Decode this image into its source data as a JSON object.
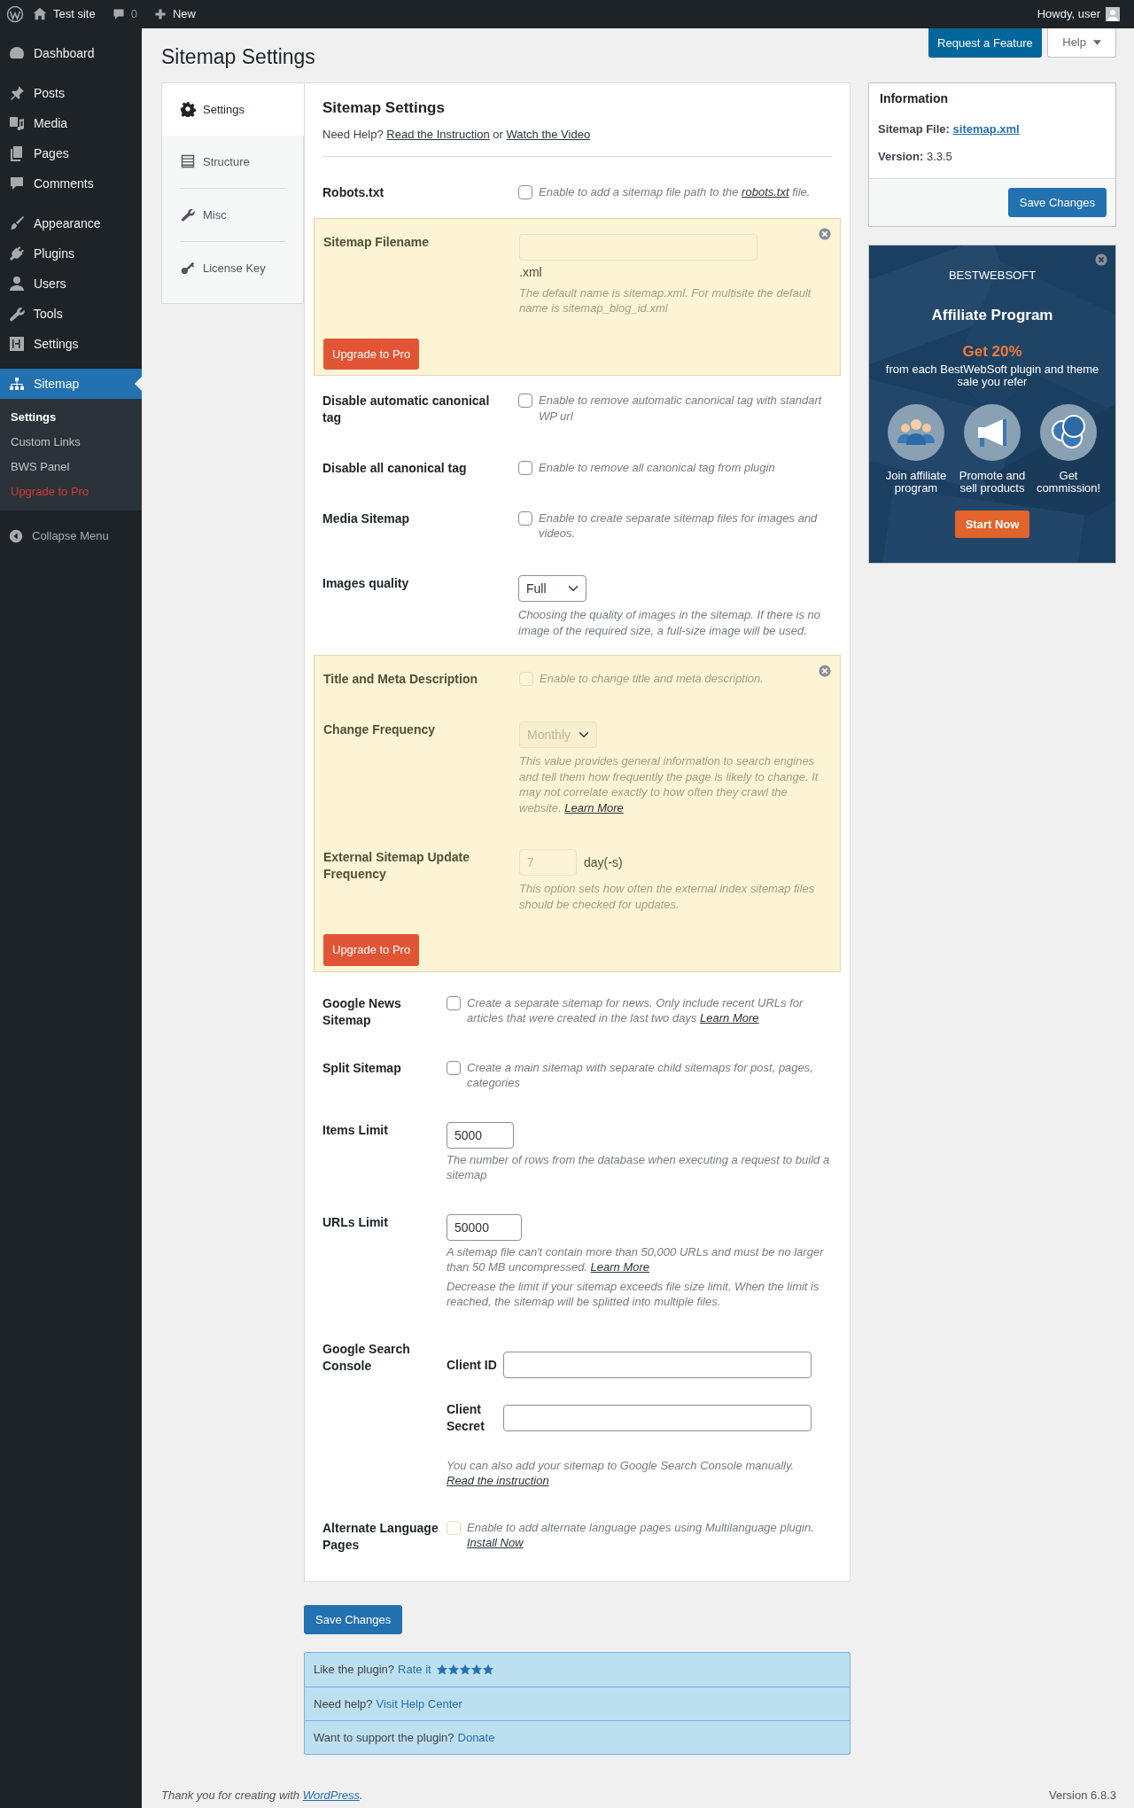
{
  "admin_bar": {
    "site": "Test site",
    "comments": "0",
    "new": "New",
    "greeting": "Howdy, user"
  },
  "sidebar": {
    "groups": [
      {
        "items": [
          {
            "label": "Dashboard",
            "selected": false
          }
        ]
      },
      {
        "items": [
          {
            "label": "Posts",
            "selected": false
          },
          {
            "label": "Media",
            "selected": false
          },
          {
            "label": "Pages",
            "selected": false
          },
          {
            "label": "Comments",
            "selected": false
          }
        ]
      },
      {
        "items": [
          {
            "label": "Appearance",
            "selected": false
          },
          {
            "label": "Plugins",
            "selected": false
          },
          {
            "label": "Users",
            "selected": false
          },
          {
            "label": "Tools",
            "selected": false
          },
          {
            "label": "Settings",
            "selected": false
          }
        ]
      },
      {
        "items": [
          {
            "label": "Sitemap",
            "selected": true,
            "children": [
              {
                "label": "Settings",
                "selected": true,
                "kind": "plain"
              },
              {
                "label": "Custom Links",
                "selected": false,
                "kind": "plain"
              },
              {
                "label": "BWS Panel",
                "selected": false,
                "kind": "plain"
              },
              {
                "label": "Upgrade to Pro",
                "selected": false,
                "kind": "upgrade"
              }
            ]
          }
        ]
      }
    ],
    "collapse": "Collapse Menu"
  },
  "page": {
    "title": "Sitemap Settings",
    "buttons": [
      {
        "label": "Request a Feature",
        "kind": "primary"
      },
      {
        "label": "Help",
        "kind": "dropdown",
        "expanded": false
      }
    ]
  },
  "tabs": [
    {
      "label": "Settings",
      "selected": true
    },
    {
      "label": "Structure",
      "selected": false
    },
    {
      "label": "Misc",
      "selected": false
    },
    {
      "label": "License Key",
      "selected": false
    }
  ],
  "form": {
    "heading": "Sitemap Settings",
    "help": [
      {
        "text": "Need Help? "
      },
      {
        "link": "Read the Instruction"
      },
      {
        "text": " or "
      },
      {
        "link": "Watch the Video"
      }
    ],
    "sections": [
      {
        "kind": "plain",
        "rows": [
          {
            "kind": "checkbox",
            "label": "Robots.txt",
            "checked": false,
            "disabled": false,
            "notes": [
              [
                {
                  "text": "Enable to add a sitemap file path to the "
                },
                {
                  "link": "robots.txt"
                },
                {
                  "text": " file."
                }
              ]
            ]
          }
        ]
      },
      {
        "kind": "pro",
        "button": "Upgrade to Pro",
        "rows": [
          {
            "kind": "filename",
            "label": "Sitemap Filename",
            "disabled": true,
            "suffix": ".xml",
            "notes": [
              [
                {
                  "text": "The default name is sitemap.xml. For multisite the default name is sitemap_blog_id.xml"
                }
              ]
            ]
          }
        ]
      },
      {
        "kind": "plain",
        "rows": [
          {
            "kind": "checkbox",
            "label": "Disable automatic canonical tag",
            "checked": false,
            "disabled": false,
            "notes": [
              [
                {
                  "text": "Enable to remove automatic canonical tag with standart WP url"
                }
              ]
            ]
          },
          {
            "kind": "checkbox",
            "label": "Disable all canonical tag",
            "checked": false,
            "disabled": false,
            "notes": [
              [
                {
                  "text": "Enable to remove all canonical tag from plugin"
                }
              ]
            ]
          },
          {
            "kind": "checkbox",
            "label": "Media Sitemap",
            "checked": false,
            "disabled": false,
            "notes": [
              [
                {
                  "text": "Enable to create separate sitemap files for images and videos."
                }
              ]
            ]
          },
          {
            "kind": "select",
            "label": "Images quality",
            "value": "Full",
            "disabled": false,
            "notes": [
              [
                {
                  "text": "Choosing the quality of images in the sitemap. If there is no image of the required size, a full-size image will be used."
                }
              ]
            ]
          }
        ]
      },
      {
        "kind": "pro",
        "button": "Upgrade to Pro",
        "rows": [
          {
            "kind": "checkbox",
            "label": "Title and Meta Description",
            "checked": false,
            "disabled": true,
            "notes": [
              [
                {
                  "text": "Enable to change title and meta description."
                }
              ]
            ]
          },
          {
            "kind": "select",
            "label": "Change Frequency",
            "value": "Monthly",
            "disabled": true,
            "notes": [
              [
                {
                  "text": "This value provides general information to search engines and tell them how frequently the page is likely to change. It may not correlate exactly to how often they crawl the website. "
                },
                {
                  "link": "Learn More"
                }
              ]
            ]
          },
          {
            "kind": "number",
            "label": "External Sitemap Update Frequency",
            "value": "7",
            "unit": "day(-s)",
            "disabled": true,
            "notes": [
              [
                {
                  "text": "This option sets how often the external index sitemap files should be checked for updates."
                }
              ]
            ]
          }
        ]
      },
      {
        "kind": "compact",
        "rows": [
          {
            "kind": "checkbox",
            "label": "Google News Sitemap",
            "checked": false,
            "disabled": false,
            "notes": [
              [
                {
                  "text": "Create a separate sitemap for news. Only include recent URLs for articles that were created in the last two days  "
                },
                {
                  "link": "Learn More"
                }
              ]
            ]
          },
          {
            "kind": "checkbox",
            "label": "Split Sitemap",
            "checked": false,
            "disabled": false,
            "notes": [
              [
                {
                  "text": "Create a main sitemap with separate child sitemaps for post, pages, categories"
                }
              ]
            ]
          },
          {
            "kind": "text",
            "label": "Items Limit",
            "value": "5000",
            "disabled": false,
            "notes": [
              [
                {
                  "text": "The number of rows from the database when executing a request to build a sitemap"
                }
              ]
            ]
          },
          {
            "kind": "text",
            "label": "URLs Limit",
            "value": "50000",
            "disabled": false,
            "notes": [
              [
                {
                  "text": "A sitemap file can't contain more than 50,000 URLs and must be no larger than 50 MB uncompressed.  "
                },
                {
                  "link": "Learn More"
                }
              ],
              [
                {
                  "text": "Decrease the limit if your sitemap exceeds file size limit. When the limit is reached, the sitemap will be splitted into multiple files."
                }
              ]
            ]
          },
          {
            "kind": "credentials",
            "label": "Google Search Console",
            "disabled": false,
            "fields": [
              {
                "label": "Client ID"
              },
              {
                "label": "Client Secret"
              }
            ],
            "notes": [
              [
                {
                  "text": "You can also add your sitemap to Google Search Console manually. "
                },
                {
                  "link": "Read the instruction"
                }
              ]
            ]
          },
          {
            "kind": "checkbox",
            "label": "Alternate Language Pages",
            "checked": false,
            "disabled": true,
            "notes": [
              [
                {
                  "text": "Enable to add alternate language pages using Multilanguage plugin. "
                },
                {
                  "link": "Install Now"
                }
              ]
            ]
          }
        ]
      }
    ]
  },
  "save_button": "Save Changes",
  "support": {
    "rows": [
      {
        "text": "Like the plugin? ",
        "link": "Rate it",
        "stars": 5
      },
      {
        "text": "Need help? ",
        "link": "Visit Help Center"
      },
      {
        "text": "Want to support the plugin? ",
        "link": "Donate"
      }
    ]
  },
  "info": {
    "title": "Information",
    "rows": [
      {
        "label": "Sitemap File:",
        "value": "sitemap.xml",
        "kind": "link"
      },
      {
        "label": "Version:",
        "value": "3.3.5",
        "kind": "text"
      }
    ],
    "button": "Save Changes"
  },
  "ad": {
    "brand": "BESTWEBSOFT",
    "title": "Affiliate Program",
    "highlight": "Get 20%",
    "text": "from each BestWebSoft plugin and theme sale you refer",
    "steps": [
      "Join affiliate program",
      "Promote and sell products",
      "Get commission!"
    ],
    "button": "Start Now"
  },
  "footer": {
    "thanks": [
      {
        "text": "Thank you for creating with "
      },
      {
        "link": "WordPress"
      },
      {
        "text": "."
      }
    ],
    "version": "Version 6.8.3"
  }
}
